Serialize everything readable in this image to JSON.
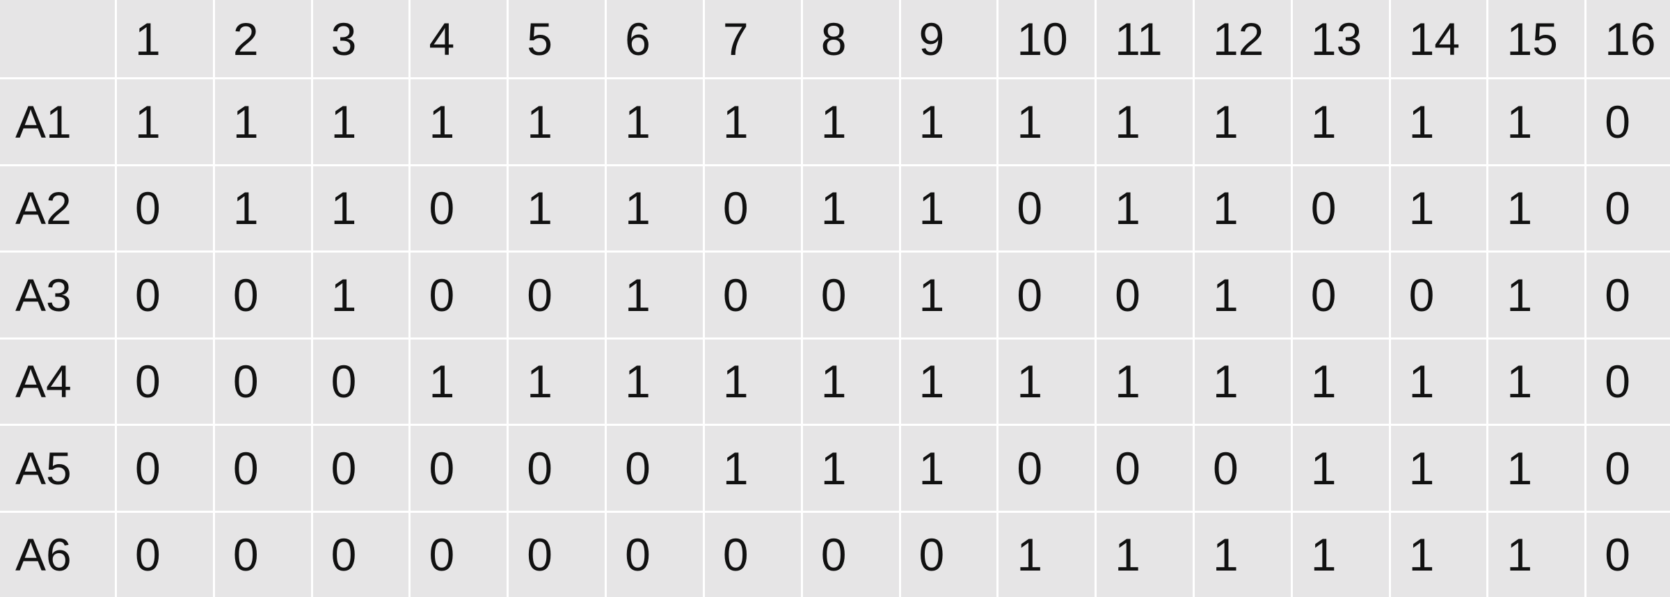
{
  "table": {
    "columns": [
      "1",
      "2",
      "3",
      "4",
      "5",
      "6",
      "7",
      "8",
      "9",
      "10",
      "11",
      "12",
      "13",
      "14",
      "15",
      "16"
    ],
    "rows": [
      {
        "label": "A1",
        "values": [
          "1",
          "1",
          "1",
          "1",
          "1",
          "1",
          "1",
          "1",
          "1",
          "1",
          "1",
          "1",
          "1",
          "1",
          "1",
          "0"
        ]
      },
      {
        "label": "A2",
        "values": [
          "0",
          "1",
          "1",
          "0",
          "1",
          "1",
          "0",
          "1",
          "1",
          "0",
          "1",
          "1",
          "0",
          "1",
          "1",
          "0"
        ]
      },
      {
        "label": "A3",
        "values": [
          "0",
          "0",
          "1",
          "0",
          "0",
          "1",
          "0",
          "0",
          "1",
          "0",
          "0",
          "1",
          "0",
          "0",
          "1",
          "0"
        ]
      },
      {
        "label": "A4",
        "values": [
          "0",
          "0",
          "0",
          "1",
          "1",
          "1",
          "1",
          "1",
          "1",
          "1",
          "1",
          "1",
          "1",
          "1",
          "1",
          "0"
        ]
      },
      {
        "label": "A5",
        "values": [
          "0",
          "0",
          "0",
          "0",
          "0",
          "0",
          "1",
          "1",
          "1",
          "0",
          "0",
          "0",
          "1",
          "1",
          "1",
          "0"
        ]
      },
      {
        "label": "A6",
        "values": [
          "0",
          "0",
          "0",
          "0",
          "0",
          "0",
          "0",
          "0",
          "0",
          "1",
          "1",
          "1",
          "1",
          "1",
          "1",
          "0"
        ]
      }
    ]
  },
  "colors": {
    "cell_background": "#e6e5e6",
    "grid_lines": "#ffffff",
    "text": "#111111"
  }
}
